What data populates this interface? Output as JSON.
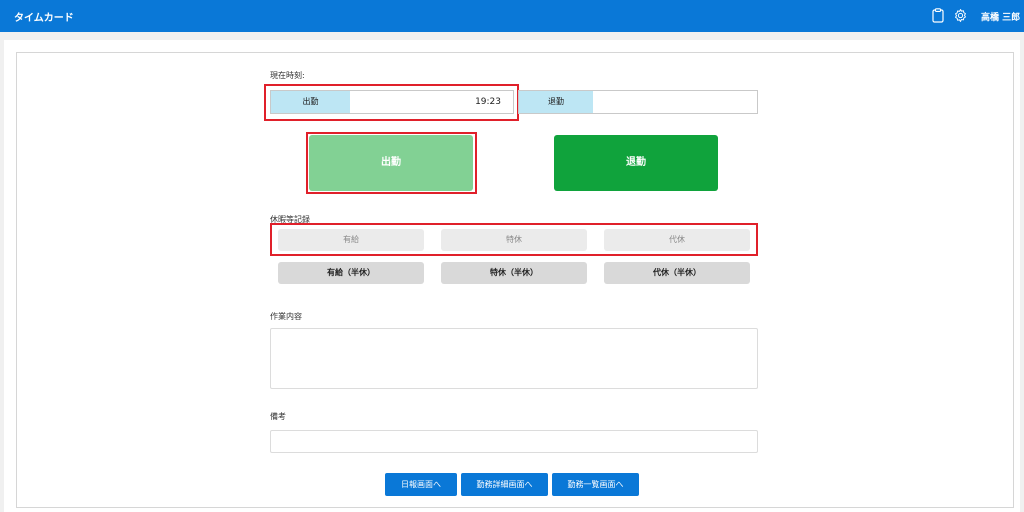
{
  "header": {
    "title": "タイムカード",
    "user": "高橋 三郎"
  },
  "current_time": {
    "label": "現在時刻:",
    "in_label": "出勤",
    "in_time": "19:23",
    "out_label": "退勤",
    "out_time": ""
  },
  "actions": {
    "clock_in": "出勤",
    "clock_out": "退勤"
  },
  "leave": {
    "label": "休暇等記録",
    "top": [
      "有給",
      "特休",
      "代休"
    ],
    "bottom": [
      "有給（半休）",
      "特休（半休）",
      "代休（半休）"
    ]
  },
  "work": {
    "label": "作業内容",
    "value": ""
  },
  "notes": {
    "label": "備考",
    "value": ""
  },
  "nav": [
    "日報画面へ",
    "勤務詳細画面へ",
    "勤務一覧画面へ"
  ],
  "colors": {
    "header": "#0a78d7",
    "clock_in": "#82d194",
    "clock_out": "#10a33c",
    "highlight": "#e0202a"
  }
}
